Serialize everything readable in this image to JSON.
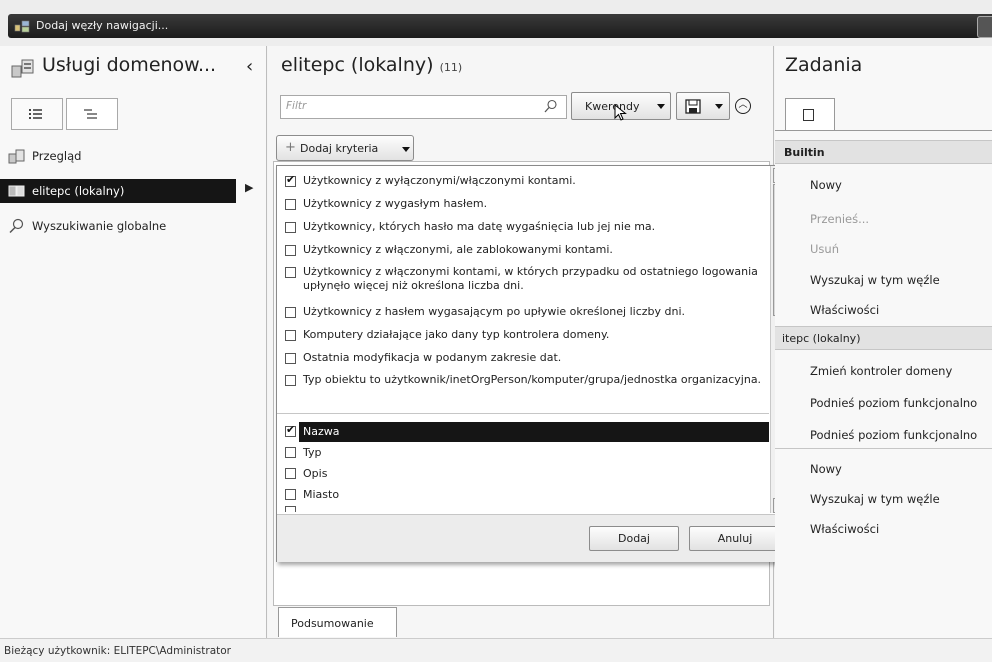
{
  "window": {
    "title": "Dodaj węzły nawigacji..."
  },
  "left": {
    "title": "Usługi domenow...",
    "items": [
      {
        "label": "Przegląd"
      },
      {
        "label": "elitepc (lokalny)"
      },
      {
        "label": "Wyszukiwanie globalne"
      }
    ]
  },
  "center": {
    "title": "elitepc (lokalny)",
    "count": "(11)",
    "filter_placeholder": "Filtr",
    "queries_label": "Kwerendy",
    "add_criteria_label": "Dodaj kryteria",
    "summary_tab": "Podsumowanie"
  },
  "criteria": {
    "items": [
      {
        "label": "Użytkownicy z wyłączonymi/włączonymi kontami.",
        "checked": true
      },
      {
        "label": "Użytkownicy z wygasłym hasłem.",
        "checked": false
      },
      {
        "label": "Użytkownicy, których hasło ma datę wygaśnięcia lub jej nie ma.",
        "checked": false
      },
      {
        "label": "Użytkownicy z włączonymi, ale zablokowanymi kontami.",
        "checked": false
      },
      {
        "label": "Użytkownicy z włączonymi kontami, w których przypadku od ostatniego logowania upłynęło więcej niż określona liczba dni.",
        "checked": false
      },
      {
        "label": "Użytkownicy z hasłem wygasającym po upływie określonej liczby dni.",
        "checked": false
      },
      {
        "label": "Komputery działające jako dany typ kontrolera domeny.",
        "checked": false
      },
      {
        "label": "Ostatnia modyfikacja w podanym zakresie dat.",
        "checked": false
      },
      {
        "label": "Typ obiektu to użytkownik/inetOrgPerson/komputer/grupa/jednostka organizacyjna.",
        "checked": false
      }
    ],
    "attributes": [
      {
        "label": "Nazwa",
        "checked": true
      },
      {
        "label": "Typ",
        "checked": false
      },
      {
        "label": "Opis",
        "checked": false
      },
      {
        "label": "Miasto",
        "checked": false
      }
    ],
    "add_button": "Dodaj",
    "cancel_button": "Anuluj"
  },
  "tasks": {
    "title": "Zadania",
    "sections": [
      {
        "header": "Builtin",
        "items": [
          {
            "label": "Nowy",
            "enabled": true
          },
          {
            "label": "Przenieś...",
            "enabled": false
          },
          {
            "label": "Usuń",
            "enabled": false
          },
          {
            "label": "Wyszukaj w tym węźle",
            "enabled": true
          },
          {
            "label": "Właściwości",
            "enabled": true
          }
        ]
      },
      {
        "header": "itepc (lokalny)",
        "items": [
          {
            "label": "Zmień kontroler domeny",
            "enabled": true
          },
          {
            "label": "Podnieś poziom funkcjonalno",
            "enabled": true
          },
          {
            "label": "Podnieś poziom funkcjonalno",
            "enabled": true
          }
        ]
      },
      {
        "header": "",
        "items": [
          {
            "label": "Nowy",
            "enabled": true
          },
          {
            "label": "Wyszukaj w tym węźle",
            "enabled": true
          },
          {
            "label": "Właściwości",
            "enabled": true
          }
        ]
      }
    ]
  },
  "status": {
    "text": "Bieżący użytkownik: ELITEPC\\Administrator"
  }
}
